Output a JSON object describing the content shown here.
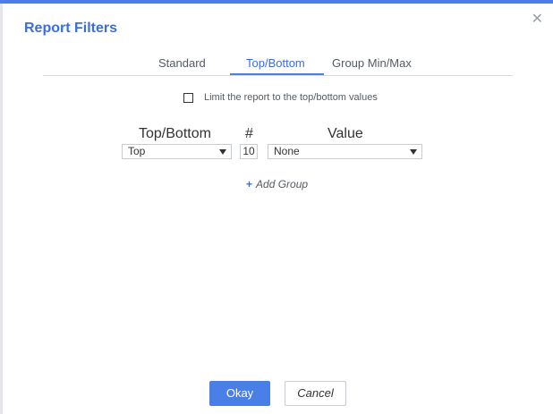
{
  "dialog": {
    "title": "Report Filters",
    "close_icon": "close-icon"
  },
  "tabs": [
    {
      "label": "Standard",
      "active": false
    },
    {
      "label": "Top/Bottom",
      "active": true
    },
    {
      "label": "Group Min/Max",
      "active": false
    }
  ],
  "limit": {
    "label": "Limit the report to the top/bottom values",
    "checked": false
  },
  "columns": {
    "top_bottom": "Top/Bottom",
    "number": "#",
    "value": "Value"
  },
  "row": {
    "top_bottom_value": "Top",
    "number_value": "10",
    "value_value": "None"
  },
  "add_group": {
    "icon": "plus-icon",
    "label": "Add Group"
  },
  "buttons": {
    "okay": "Okay",
    "cancel": "Cancel"
  },
  "colors": {
    "accent": "#4a7fe8",
    "title": "#3c6fd6"
  }
}
